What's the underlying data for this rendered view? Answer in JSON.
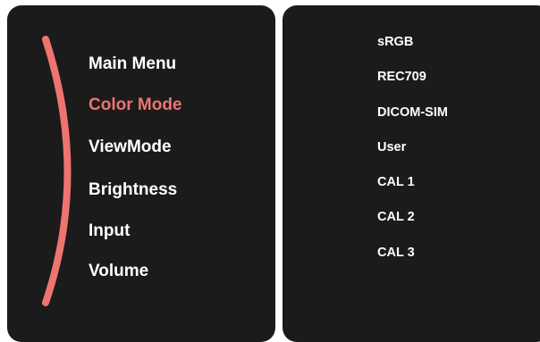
{
  "main_menu": {
    "items": [
      {
        "label": "Main Menu"
      },
      {
        "label": "Color Mode"
      },
      {
        "label": "ViewMode"
      },
      {
        "label": "Brightness"
      },
      {
        "label": "Input"
      },
      {
        "label": "Volume"
      }
    ],
    "active_index": 1
  },
  "color_mode_menu": {
    "options": [
      {
        "label": "sRGB"
      },
      {
        "label": "REC709"
      },
      {
        "label": "DICOM-SIM"
      },
      {
        "label": "User"
      },
      {
        "label": "CAL 1"
      },
      {
        "label": "CAL 2"
      },
      {
        "label": "CAL 3"
      }
    ]
  },
  "colors": {
    "panel_background": "#1b1b1b",
    "accent": "#ee7470",
    "text": "#ffffff"
  }
}
